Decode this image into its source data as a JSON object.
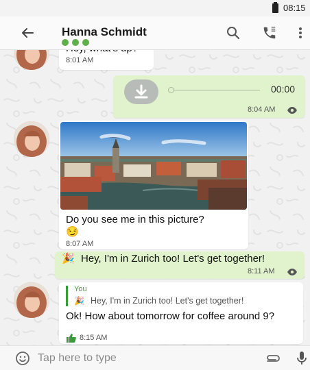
{
  "status_bar": {
    "time": "08:15"
  },
  "header": {
    "contact_name": "Hanna Schmidt",
    "trust_level": 3,
    "back_icon": "arrow-left-icon",
    "search_icon": "search-icon",
    "call_icon": "phone-icon",
    "menu_icon": "more-vertical-icon"
  },
  "messages": [
    {
      "direction": "incoming",
      "text": "Hey, what's up?",
      "time": "8:01 AM"
    },
    {
      "direction": "outgoing",
      "type": "voice",
      "duration": "00:00",
      "time": "8:04 AM",
      "status_icon": "eye-icon"
    },
    {
      "direction": "incoming",
      "type": "image",
      "image_subject": "city-riverside-photo",
      "text": "Do you see me in this picture?",
      "emoji": "😏",
      "time": "8:07 AM"
    },
    {
      "direction": "outgoing",
      "emoji": "🎉",
      "text": "Hey, I'm in Zurich too!  Let's get together!",
      "time": "8:11 AM",
      "status_icon": "eye-icon"
    },
    {
      "direction": "incoming",
      "quote_author": "You",
      "quote_emoji": "🎉",
      "quote_text": "Hey, I'm in Zurich too!  Let's get together!",
      "text": "Ok! How about tomorrow for coffee around 9?",
      "time": "8:15 AM",
      "status_icon": "thumbs-up-icon"
    }
  ],
  "composer": {
    "placeholder": "Tap here to type",
    "emoji_icon": "smiley-icon",
    "attach_icon": "paperclip-icon",
    "mic_icon": "microphone-icon"
  },
  "colors": {
    "accent": "#5fb04a",
    "outgoing_bubble": "#e1f3cd",
    "incoming_bubble": "#ffffff",
    "voice_button": "#b8bcb8",
    "quote_bar": "#3a9a3a"
  }
}
